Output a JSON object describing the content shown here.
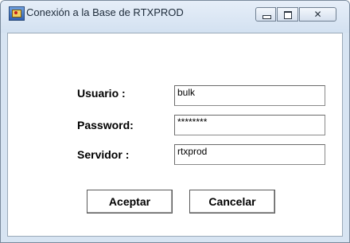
{
  "window": {
    "title": "Conexión a la Base de RTXPROD",
    "close_glyph": "✕"
  },
  "form": {
    "usuario_label": "Usuario :",
    "usuario_value": "bulk",
    "password_label": "Password:",
    "password_value": "********",
    "servidor_label": "Servidor :",
    "servidor_value": "rtxprod"
  },
  "buttons": {
    "accept_label": "Aceptar",
    "cancel_label": "Cancelar"
  }
}
